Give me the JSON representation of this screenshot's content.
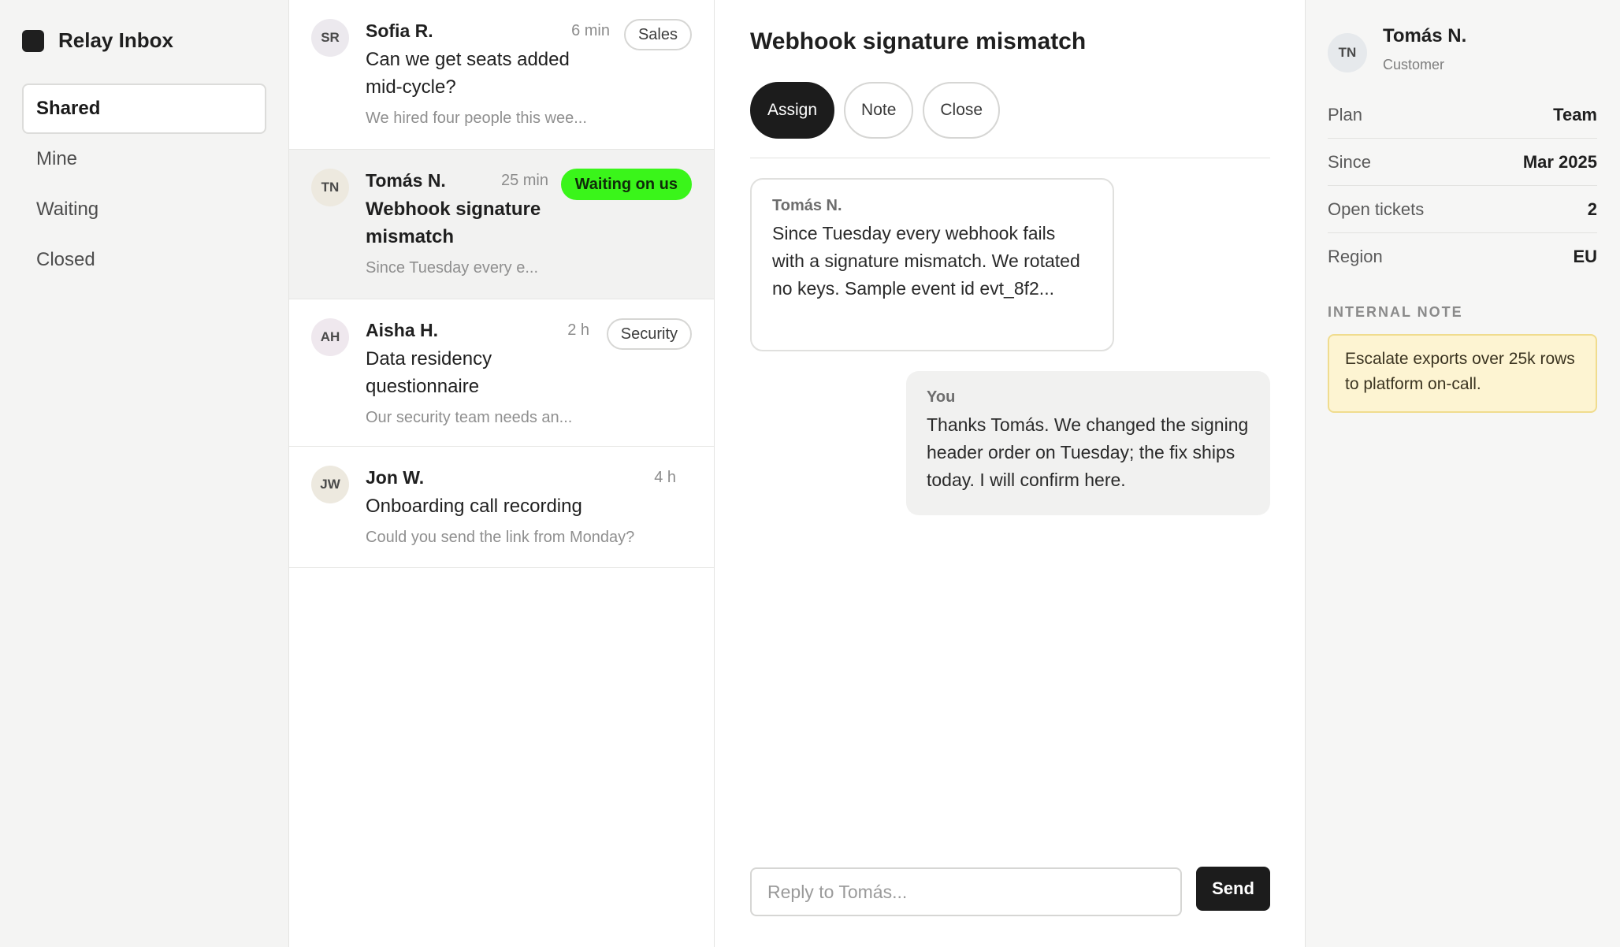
{
  "sidebar": {
    "brand": "Relay Inbox",
    "nav": [
      {
        "label": "Shared"
      },
      {
        "label": "Mine"
      },
      {
        "label": "Waiting"
      },
      {
        "label": "Closed"
      }
    ]
  },
  "conversations": [
    {
      "initials": "SR",
      "avatar_color": "#ece9ee",
      "name": "Sofia R.",
      "time": "6 min",
      "tag": "Sales",
      "subject": "Can we get seats added mid-cycle?",
      "preview": "We hired four people this wee..."
    },
    {
      "initials": "TN",
      "avatar_color": "#ede9df",
      "name": "Tomás N.",
      "time": "25 min",
      "tag": "Waiting on us",
      "subject": "Webhook signature mismatch",
      "preview": "Since Tuesday every e..."
    },
    {
      "initials": "AH",
      "avatar_color": "#efe8ee",
      "name": "Aisha H.",
      "time": "2 h",
      "tag": "Security",
      "subject": "Data residency questionnaire",
      "preview": "Our security team needs an..."
    },
    {
      "initials": "JW",
      "avatar_color": "#ede9df",
      "name": "Jon W.",
      "time": "4 h",
      "tag": "",
      "subject": "Onboarding call recording",
      "preview": "Could you send the link from Monday?"
    }
  ],
  "thread": {
    "title": "Webhook signature mismatch",
    "actions": {
      "assign": "Assign",
      "note": "Note",
      "close": "Close"
    },
    "messages": [
      {
        "author": "Tomás N.",
        "text": "Since Tuesday every webhook fails with a signature mismatch. We rotated no keys. Sample event id evt_8f2..."
      },
      {
        "author": "You",
        "text": "Thanks Tomás. We changed the signing header order on Tuesday; the fix ships today. I will confirm here."
      }
    ],
    "composer": {
      "placeholder": "Reply to Tomás...",
      "value": "",
      "send_label": "Send"
    }
  },
  "customer": {
    "initials": "TN",
    "name": "Tomás N.",
    "role": "Customer",
    "properties": [
      {
        "key": "Plan",
        "value": "Team"
      },
      {
        "key": "Since",
        "value": "Mar 2025"
      },
      {
        "key": "Open tickets",
        "value": "2"
      },
      {
        "key": "Region",
        "value": "EU"
      }
    ],
    "note_heading": "INTERNAL NOTE",
    "note_text": "Escalate exports over 25k rows to platform on-call."
  },
  "colors": {
    "accent_dark": "#1c1c1c",
    "status_green": "#3af51a",
    "note_bg": "#fdf4d2"
  }
}
